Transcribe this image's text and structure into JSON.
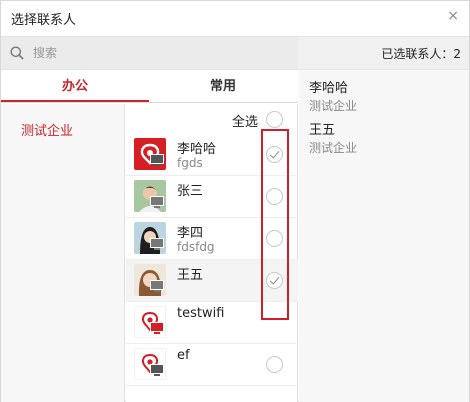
{
  "window": {
    "title": "选择联系人",
    "close_symbol": "×"
  },
  "search": {
    "placeholder": "搜索"
  },
  "selected_header": "已选联系人：2",
  "tabs": [
    {
      "label": "办公",
      "active": true
    },
    {
      "label": "常用",
      "active": false
    }
  ],
  "orgs": [
    {
      "label": "测试企业",
      "active": true
    }
  ],
  "select_all": {
    "label": "全选",
    "checked": false
  },
  "contacts": [
    {
      "name": "李哈哈",
      "sub": "fgds",
      "checked": true,
      "avatar": "red-logo"
    },
    {
      "name": "张三",
      "sub": "",
      "checked": false,
      "avatar": "photo-child"
    },
    {
      "name": "李四",
      "sub": "fdsfdg",
      "checked": false,
      "avatar": "photo-girl"
    },
    {
      "name": "王五",
      "sub": "",
      "checked": true,
      "avatar": "photo-woman"
    },
    {
      "name": "testwifi",
      "sub": "",
      "checked": false,
      "avatar": "default-logo"
    },
    {
      "name": "ef",
      "sub": "",
      "checked": false,
      "avatar": "default-logo"
    }
  ],
  "selected_contacts": [
    {
      "name": "李哈哈",
      "org": "测试企业"
    },
    {
      "name": "王五",
      "org": "测试企业"
    }
  ],
  "colors": {
    "accent": "#c9242a",
    "highlight": "#d01f2a"
  }
}
